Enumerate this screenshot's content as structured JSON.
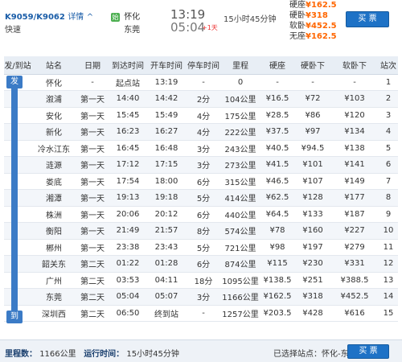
{
  "header": {
    "train_no": "K9059/K9062",
    "detail_label": "详情",
    "train_type": "快速",
    "from_station": "怀化",
    "from_badge": "始",
    "to_station": "东莞",
    "dep_time": "13:19",
    "arr_time": "05:04",
    "plus_day": "+1天",
    "duration": "15小时45分钟",
    "prices": [
      {
        "label": "硬座",
        "price": "¥162.5"
      },
      {
        "label": "硬卧",
        "price": "¥318"
      },
      {
        "label": "软卧",
        "price": "¥452.5"
      },
      {
        "label": "无座",
        "price": "¥162.5"
      }
    ],
    "buy_label": "买 票"
  },
  "table": {
    "headers": [
      "发/到站",
      "站名",
      "日期",
      "到达时间",
      "开车时间",
      "停车时间",
      "里程",
      "硬座",
      "硬卧下",
      "软卧下",
      "站次"
    ],
    "rail_start": "发",
    "rail_end": "到",
    "rows": [
      [
        "怀化",
        "-",
        "起点站",
        "13:19",
        "-",
        "0",
        "-",
        "-",
        "-",
        "1"
      ],
      [
        "溆浦",
        "第一天",
        "14:40",
        "14:42",
        "2分",
        "104公里",
        "¥16.5",
        "¥72",
        "¥103",
        "2"
      ],
      [
        "安化",
        "第一天",
        "15:45",
        "15:49",
        "4分",
        "175公里",
        "¥28.5",
        "¥86",
        "¥120",
        "3"
      ],
      [
        "新化",
        "第一天",
        "16:23",
        "16:27",
        "4分",
        "222公里",
        "¥37.5",
        "¥97",
        "¥134",
        "4"
      ],
      [
        "冷水江东",
        "第一天",
        "16:45",
        "16:48",
        "3分",
        "243公里",
        "¥40.5",
        "¥94.5",
        "¥138",
        "5"
      ],
      [
        "涟源",
        "第一天",
        "17:12",
        "17:15",
        "3分",
        "273公里",
        "¥41.5",
        "¥101",
        "¥141",
        "6"
      ],
      [
        "娄底",
        "第一天",
        "17:54",
        "18:00",
        "6分",
        "315公里",
        "¥46.5",
        "¥107",
        "¥149",
        "7"
      ],
      [
        "湘潭",
        "第一天",
        "19:13",
        "19:18",
        "5分",
        "414公里",
        "¥62.5",
        "¥128",
        "¥177",
        "8"
      ],
      [
        "株洲",
        "第一天",
        "20:06",
        "20:12",
        "6分",
        "440公里",
        "¥64.5",
        "¥133",
        "¥187",
        "9"
      ],
      [
        "衡阳",
        "第一天",
        "21:49",
        "21:57",
        "8分",
        "574公里",
        "¥78",
        "¥160",
        "¥227",
        "10"
      ],
      [
        "郴州",
        "第一天",
        "23:38",
        "23:43",
        "5分",
        "721公里",
        "¥98",
        "¥197",
        "¥279",
        "11"
      ],
      [
        "韶关东",
        "第二天",
        "01:22",
        "01:28",
        "6分",
        "874公里",
        "¥115",
        "¥230",
        "¥331",
        "12"
      ],
      [
        "广州",
        "第二天",
        "03:53",
        "04:11",
        "18分",
        "1095公里",
        "¥138.5",
        "¥251",
        "¥388.5",
        "13"
      ],
      [
        "东莞",
        "第二天",
        "05:04",
        "05:07",
        "3分",
        "1166公里",
        "¥162.5",
        "¥318",
        "¥452.5",
        "14"
      ],
      [
        "深圳西",
        "第二天",
        "06:50",
        "终到站",
        "-",
        "1257公里",
        "¥203.5",
        "¥428",
        "¥616",
        "15"
      ]
    ]
  },
  "footer": {
    "mileage_label": "里程数：",
    "mileage_value": "1166公里",
    "runtime_label": "运行时间：",
    "runtime_value": "15小时45分钟",
    "selected_label": "已选择站点：怀化-东莞",
    "buy_label": "买 票"
  },
  "colors": {
    "accent": "#1e72c6",
    "price": "#ff6600",
    "rail": "#3b7bc6"
  }
}
